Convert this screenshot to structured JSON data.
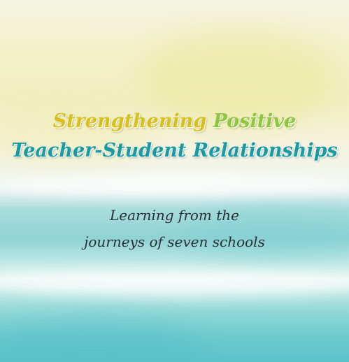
{
  "title": {
    "line1_part1": "Strengthening",
    "line1_part2": "Positive",
    "line2": "Teacher-Student Relationships"
  },
  "subtitle": {
    "line1": "Learning from the",
    "line2": "journeys of seven schools"
  },
  "colors": {
    "title_yellow": "#d8c01c",
    "title_green": "#8cc73e",
    "title_teal": "#1c9aa3",
    "subtitle_text": "#2b2f33"
  }
}
